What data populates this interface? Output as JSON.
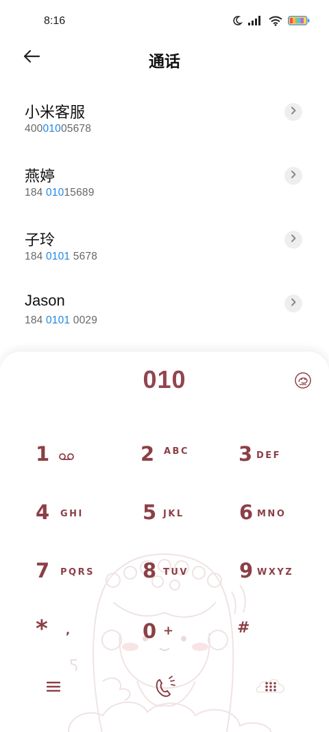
{
  "status_bar": {
    "time": "8:16",
    "icons": [
      "moon-icon",
      "signal-icon",
      "wifi-icon",
      "battery-icon"
    ]
  },
  "header": {
    "back_icon": "back-arrow-icon",
    "title": "通话"
  },
  "results": [
    {
      "name": "小米客服",
      "number_pre": "400",
      "number_match": "010",
      "number_post": "05678"
    },
    {
      "name": "燕婷",
      "number_pre": "184 ",
      "number_match": "010",
      "number_post": "15689"
    },
    {
      "name": "子玲",
      "number_pre": "184 ",
      "number_match": "0101",
      "number_post": " 5678"
    },
    {
      "name": "Jason",
      "number_pre": "184 ",
      "number_match": "0101",
      "number_post": " 0029"
    }
  ],
  "dialer": {
    "input_value": "010",
    "keys": [
      {
        "digit": "1",
        "letters": "",
        "icon": "voicemail-icon"
      },
      {
        "digit": "2",
        "letters": "ABC"
      },
      {
        "digit": "3",
        "letters": "DEF"
      },
      {
        "digit": "4",
        "letters": "GHI"
      },
      {
        "digit": "5",
        "letters": "JKL"
      },
      {
        "digit": "6",
        "letters": "MNO"
      },
      {
        "digit": "7",
        "letters": "PQRS"
      },
      {
        "digit": "8",
        "letters": "TUV"
      },
      {
        "digit": "9",
        "letters": "WXYZ"
      },
      {
        "digit": "*",
        "letters": ","
      },
      {
        "digit": "0",
        "letters": "+"
      },
      {
        "digit": "#",
        "letters": ""
      }
    ],
    "bottom": {
      "menu_icon": "menu-icon",
      "call_icon": "call-icon",
      "keypad_icon": "keypad-icon"
    }
  },
  "colors": {
    "accent_match": "#1e88e5",
    "dial_text": "#93454f",
    "key_text": "#8c3f46"
  }
}
